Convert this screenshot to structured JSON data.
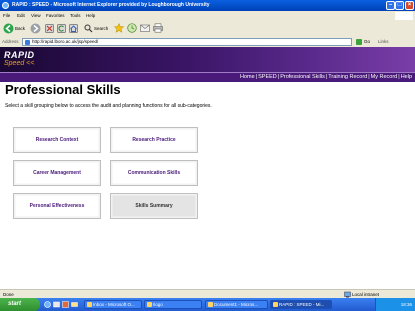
{
  "window": {
    "title": "RAPID : SPEED - Microsoft Internet Explorer provided by Loughborough University"
  },
  "menu": [
    "File",
    "Edit",
    "View",
    "Favorites",
    "Tools",
    "Help"
  ],
  "toolbar": {
    "back_label": "Back",
    "search_label": "Search"
  },
  "address": {
    "label": "Address",
    "url": "http://rapid.lboro.ac.uk/jsp/speed/",
    "go_label": "Go",
    "links_label": "Links"
  },
  "site": {
    "logo_top": "RAPID",
    "logo_bottom": "Speed <<",
    "nav": [
      "Home",
      "SPEED",
      "Professional Skills",
      "Training Record",
      "My Record",
      "Help"
    ]
  },
  "content": {
    "title": "Professional Skills",
    "intro": "Select a skill grouping below to access the audit and planning functions for all sub-categories.",
    "skills": [
      {
        "label": "Research Context"
      },
      {
        "label": "Research Practice"
      },
      {
        "label": "Career Management"
      },
      {
        "label": "Communication Skills"
      },
      {
        "label": "Personal Effectiveness"
      },
      {
        "label": "Skills Summary"
      }
    ]
  },
  "statusbar": {
    "status": "Done",
    "zone": "Local intranet"
  },
  "taskbar": {
    "start": "start",
    "tasks": [
      "Inbox - Microsoft O...",
      "Ilogo",
      "Document1 - Micros...",
      "RAPID : SPEED - Mi..."
    ],
    "clock": "18:36"
  },
  "colors": {
    "titlebar": "#0a5fe0",
    "header_purple": "#4a1a7a",
    "speed_orange": "#f0a020",
    "skill_text": "#4a1a7a"
  }
}
